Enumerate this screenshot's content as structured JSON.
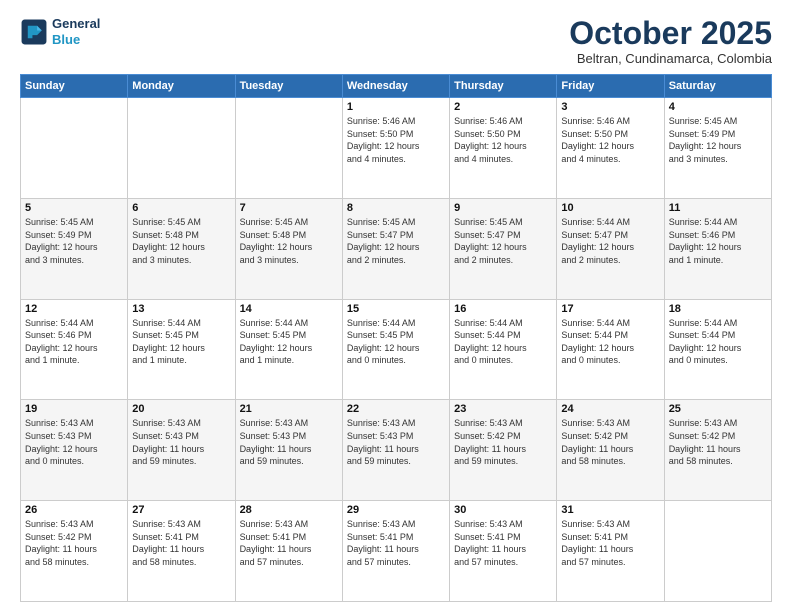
{
  "logo": {
    "line1": "General",
    "line2": "Blue"
  },
  "title": "October 2025",
  "subtitle": "Beltran, Cundinamarca, Colombia",
  "days_of_week": [
    "Sunday",
    "Monday",
    "Tuesday",
    "Wednesday",
    "Thursday",
    "Friday",
    "Saturday"
  ],
  "weeks": [
    [
      {
        "day": "",
        "info": ""
      },
      {
        "day": "",
        "info": ""
      },
      {
        "day": "",
        "info": ""
      },
      {
        "day": "1",
        "info": "Sunrise: 5:46 AM\nSunset: 5:50 PM\nDaylight: 12 hours\nand 4 minutes."
      },
      {
        "day": "2",
        "info": "Sunrise: 5:46 AM\nSunset: 5:50 PM\nDaylight: 12 hours\nand 4 minutes."
      },
      {
        "day": "3",
        "info": "Sunrise: 5:46 AM\nSunset: 5:50 PM\nDaylight: 12 hours\nand 4 minutes."
      },
      {
        "day": "4",
        "info": "Sunrise: 5:45 AM\nSunset: 5:49 PM\nDaylight: 12 hours\nand 3 minutes."
      }
    ],
    [
      {
        "day": "5",
        "info": "Sunrise: 5:45 AM\nSunset: 5:49 PM\nDaylight: 12 hours\nand 3 minutes."
      },
      {
        "day": "6",
        "info": "Sunrise: 5:45 AM\nSunset: 5:48 PM\nDaylight: 12 hours\nand 3 minutes."
      },
      {
        "day": "7",
        "info": "Sunrise: 5:45 AM\nSunset: 5:48 PM\nDaylight: 12 hours\nand 3 minutes."
      },
      {
        "day": "8",
        "info": "Sunrise: 5:45 AM\nSunset: 5:47 PM\nDaylight: 12 hours\nand 2 minutes."
      },
      {
        "day": "9",
        "info": "Sunrise: 5:45 AM\nSunset: 5:47 PM\nDaylight: 12 hours\nand 2 minutes."
      },
      {
        "day": "10",
        "info": "Sunrise: 5:44 AM\nSunset: 5:47 PM\nDaylight: 12 hours\nand 2 minutes."
      },
      {
        "day": "11",
        "info": "Sunrise: 5:44 AM\nSunset: 5:46 PM\nDaylight: 12 hours\nand 1 minute."
      }
    ],
    [
      {
        "day": "12",
        "info": "Sunrise: 5:44 AM\nSunset: 5:46 PM\nDaylight: 12 hours\nand 1 minute."
      },
      {
        "day": "13",
        "info": "Sunrise: 5:44 AM\nSunset: 5:45 PM\nDaylight: 12 hours\nand 1 minute."
      },
      {
        "day": "14",
        "info": "Sunrise: 5:44 AM\nSunset: 5:45 PM\nDaylight: 12 hours\nand 1 minute."
      },
      {
        "day": "15",
        "info": "Sunrise: 5:44 AM\nSunset: 5:45 PM\nDaylight: 12 hours\nand 0 minutes."
      },
      {
        "day": "16",
        "info": "Sunrise: 5:44 AM\nSunset: 5:44 PM\nDaylight: 12 hours\nand 0 minutes."
      },
      {
        "day": "17",
        "info": "Sunrise: 5:44 AM\nSunset: 5:44 PM\nDaylight: 12 hours\nand 0 minutes."
      },
      {
        "day": "18",
        "info": "Sunrise: 5:44 AM\nSunset: 5:44 PM\nDaylight: 12 hours\nand 0 minutes."
      }
    ],
    [
      {
        "day": "19",
        "info": "Sunrise: 5:43 AM\nSunset: 5:43 PM\nDaylight: 12 hours\nand 0 minutes."
      },
      {
        "day": "20",
        "info": "Sunrise: 5:43 AM\nSunset: 5:43 PM\nDaylight: 11 hours\nand 59 minutes."
      },
      {
        "day": "21",
        "info": "Sunrise: 5:43 AM\nSunset: 5:43 PM\nDaylight: 11 hours\nand 59 minutes."
      },
      {
        "day": "22",
        "info": "Sunrise: 5:43 AM\nSunset: 5:43 PM\nDaylight: 11 hours\nand 59 minutes."
      },
      {
        "day": "23",
        "info": "Sunrise: 5:43 AM\nSunset: 5:42 PM\nDaylight: 11 hours\nand 59 minutes."
      },
      {
        "day": "24",
        "info": "Sunrise: 5:43 AM\nSunset: 5:42 PM\nDaylight: 11 hours\nand 58 minutes."
      },
      {
        "day": "25",
        "info": "Sunrise: 5:43 AM\nSunset: 5:42 PM\nDaylight: 11 hours\nand 58 minutes."
      }
    ],
    [
      {
        "day": "26",
        "info": "Sunrise: 5:43 AM\nSunset: 5:42 PM\nDaylight: 11 hours\nand 58 minutes."
      },
      {
        "day": "27",
        "info": "Sunrise: 5:43 AM\nSunset: 5:41 PM\nDaylight: 11 hours\nand 58 minutes."
      },
      {
        "day": "28",
        "info": "Sunrise: 5:43 AM\nSunset: 5:41 PM\nDaylight: 11 hours\nand 57 minutes."
      },
      {
        "day": "29",
        "info": "Sunrise: 5:43 AM\nSunset: 5:41 PM\nDaylight: 11 hours\nand 57 minutes."
      },
      {
        "day": "30",
        "info": "Sunrise: 5:43 AM\nSunset: 5:41 PM\nDaylight: 11 hours\nand 57 minutes."
      },
      {
        "day": "31",
        "info": "Sunrise: 5:43 AM\nSunset: 5:41 PM\nDaylight: 11 hours\nand 57 minutes."
      },
      {
        "day": "",
        "info": ""
      }
    ]
  ]
}
